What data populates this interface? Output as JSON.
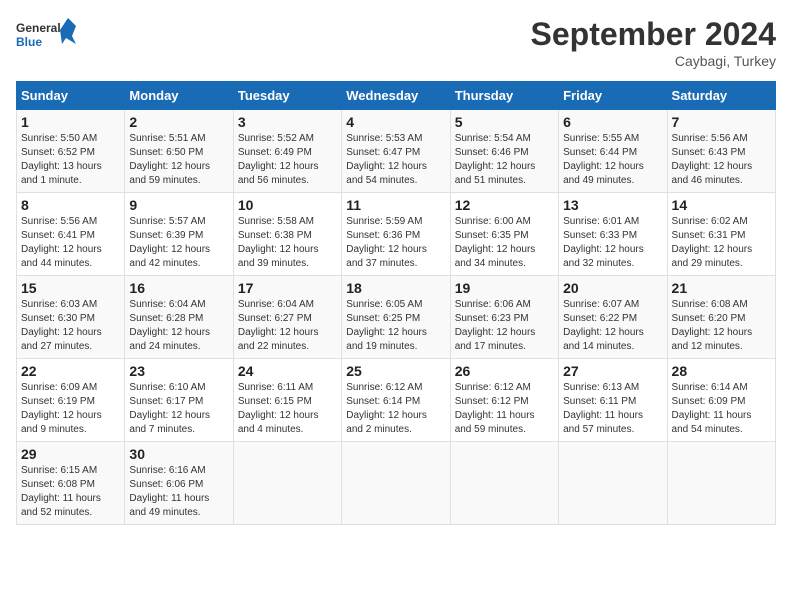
{
  "header": {
    "logo_line1": "General",
    "logo_line2": "Blue",
    "month_title": "September 2024",
    "location": "Caybagi, Turkey"
  },
  "weekdays": [
    "Sunday",
    "Monday",
    "Tuesday",
    "Wednesday",
    "Thursday",
    "Friday",
    "Saturday"
  ],
  "weeks": [
    [
      {
        "day": "1",
        "info": "Sunrise: 5:50 AM\nSunset: 6:52 PM\nDaylight: 13 hours\nand 1 minute."
      },
      {
        "day": "2",
        "info": "Sunrise: 5:51 AM\nSunset: 6:50 PM\nDaylight: 12 hours\nand 59 minutes."
      },
      {
        "day": "3",
        "info": "Sunrise: 5:52 AM\nSunset: 6:49 PM\nDaylight: 12 hours\nand 56 minutes."
      },
      {
        "day": "4",
        "info": "Sunrise: 5:53 AM\nSunset: 6:47 PM\nDaylight: 12 hours\nand 54 minutes."
      },
      {
        "day": "5",
        "info": "Sunrise: 5:54 AM\nSunset: 6:46 PM\nDaylight: 12 hours\nand 51 minutes."
      },
      {
        "day": "6",
        "info": "Sunrise: 5:55 AM\nSunset: 6:44 PM\nDaylight: 12 hours\nand 49 minutes."
      },
      {
        "day": "7",
        "info": "Sunrise: 5:56 AM\nSunset: 6:43 PM\nDaylight: 12 hours\nand 46 minutes."
      }
    ],
    [
      {
        "day": "8",
        "info": "Sunrise: 5:56 AM\nSunset: 6:41 PM\nDaylight: 12 hours\nand 44 minutes."
      },
      {
        "day": "9",
        "info": "Sunrise: 5:57 AM\nSunset: 6:39 PM\nDaylight: 12 hours\nand 42 minutes."
      },
      {
        "day": "10",
        "info": "Sunrise: 5:58 AM\nSunset: 6:38 PM\nDaylight: 12 hours\nand 39 minutes."
      },
      {
        "day": "11",
        "info": "Sunrise: 5:59 AM\nSunset: 6:36 PM\nDaylight: 12 hours\nand 37 minutes."
      },
      {
        "day": "12",
        "info": "Sunrise: 6:00 AM\nSunset: 6:35 PM\nDaylight: 12 hours\nand 34 minutes."
      },
      {
        "day": "13",
        "info": "Sunrise: 6:01 AM\nSunset: 6:33 PM\nDaylight: 12 hours\nand 32 minutes."
      },
      {
        "day": "14",
        "info": "Sunrise: 6:02 AM\nSunset: 6:31 PM\nDaylight: 12 hours\nand 29 minutes."
      }
    ],
    [
      {
        "day": "15",
        "info": "Sunrise: 6:03 AM\nSunset: 6:30 PM\nDaylight: 12 hours\nand 27 minutes."
      },
      {
        "day": "16",
        "info": "Sunrise: 6:04 AM\nSunset: 6:28 PM\nDaylight: 12 hours\nand 24 minutes."
      },
      {
        "day": "17",
        "info": "Sunrise: 6:04 AM\nSunset: 6:27 PM\nDaylight: 12 hours\nand 22 minutes."
      },
      {
        "day": "18",
        "info": "Sunrise: 6:05 AM\nSunset: 6:25 PM\nDaylight: 12 hours\nand 19 minutes."
      },
      {
        "day": "19",
        "info": "Sunrise: 6:06 AM\nSunset: 6:23 PM\nDaylight: 12 hours\nand 17 minutes."
      },
      {
        "day": "20",
        "info": "Sunrise: 6:07 AM\nSunset: 6:22 PM\nDaylight: 12 hours\nand 14 minutes."
      },
      {
        "day": "21",
        "info": "Sunrise: 6:08 AM\nSunset: 6:20 PM\nDaylight: 12 hours\nand 12 minutes."
      }
    ],
    [
      {
        "day": "22",
        "info": "Sunrise: 6:09 AM\nSunset: 6:19 PM\nDaylight: 12 hours\nand 9 minutes."
      },
      {
        "day": "23",
        "info": "Sunrise: 6:10 AM\nSunset: 6:17 PM\nDaylight: 12 hours\nand 7 minutes."
      },
      {
        "day": "24",
        "info": "Sunrise: 6:11 AM\nSunset: 6:15 PM\nDaylight: 12 hours\nand 4 minutes."
      },
      {
        "day": "25",
        "info": "Sunrise: 6:12 AM\nSunset: 6:14 PM\nDaylight: 12 hours\nand 2 minutes."
      },
      {
        "day": "26",
        "info": "Sunrise: 6:12 AM\nSunset: 6:12 PM\nDaylight: 11 hours\nand 59 minutes."
      },
      {
        "day": "27",
        "info": "Sunrise: 6:13 AM\nSunset: 6:11 PM\nDaylight: 11 hours\nand 57 minutes."
      },
      {
        "day": "28",
        "info": "Sunrise: 6:14 AM\nSunset: 6:09 PM\nDaylight: 11 hours\nand 54 minutes."
      }
    ],
    [
      {
        "day": "29",
        "info": "Sunrise: 6:15 AM\nSunset: 6:08 PM\nDaylight: 11 hours\nand 52 minutes."
      },
      {
        "day": "30",
        "info": "Sunrise: 6:16 AM\nSunset: 6:06 PM\nDaylight: 11 hours\nand 49 minutes."
      },
      {
        "day": "",
        "info": ""
      },
      {
        "day": "",
        "info": ""
      },
      {
        "day": "",
        "info": ""
      },
      {
        "day": "",
        "info": ""
      },
      {
        "day": "",
        "info": ""
      }
    ]
  ]
}
